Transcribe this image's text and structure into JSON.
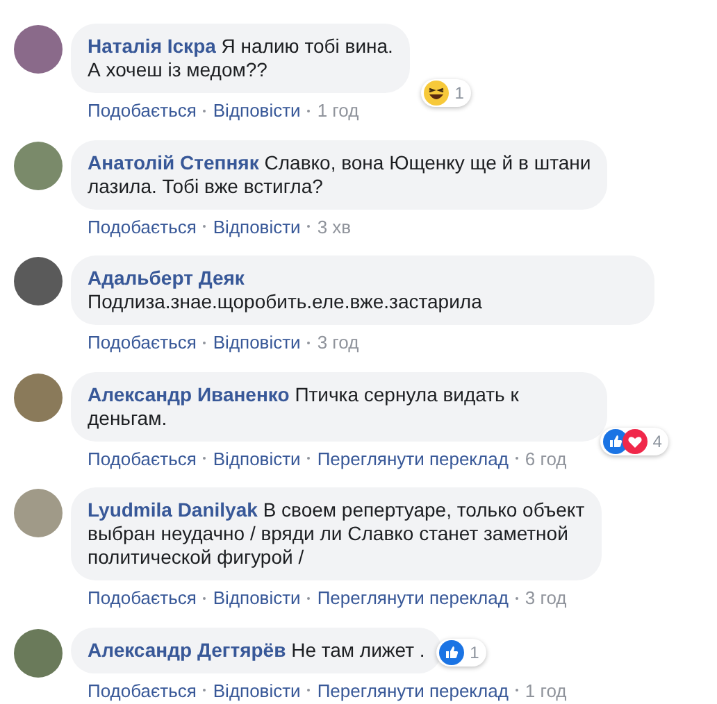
{
  "comments": [
    {
      "author": "Наталія Іскра",
      "text": "Я налию тобі вина.\nА хочеш із медом??",
      "actions": [
        "Подобається",
        "Відповісти"
      ],
      "time": "1 год",
      "reactions": {
        "icons": [
          {
            "kind": "haha"
          }
        ],
        "count": "1"
      }
    },
    {
      "author": "Анатолій Степняк",
      "text": "Славко, вона Ющенку ще й в штани\nлазила. Тобі вже встигла?",
      "actions": [
        "Подобається",
        "Відповісти"
      ],
      "time": "3 хв"
    },
    {
      "author": "Адальберт Деяк",
      "text": "Подлиза.знае.щоробить.еле.вже.застарила",
      "actions": [
        "Подобається",
        "Відповісти"
      ],
      "time": "3 год"
    },
    {
      "author": "Александр Иваненко",
      "text": "Птичка сернула видать к\nденьгам.",
      "actions": [
        "Подобається",
        "Відповісти",
        "Переглянути переклад"
      ],
      "time": "6 год",
      "reactions": {
        "icons": [
          {
            "kind": "like"
          },
          {
            "kind": "love"
          }
        ],
        "count": "4"
      }
    },
    {
      "author": "Lyudmila Danilyak",
      "text": "В своем репертуаре, только объект\nвыбран неудачно / вряди ли Славко станет заметной\nполитической фигурой /",
      "actions": [
        "Подобається",
        "Відповісти",
        "Переглянути переклад"
      ],
      "time": "3 год"
    },
    {
      "author": "Александр Дегтярёв",
      "text": "Не там лижет .",
      "actions": [
        "Подобається",
        "Відповісти",
        "Переглянути переклад"
      ],
      "time": "1 год",
      "reactions": {
        "icons": [
          {
            "kind": "like"
          }
        ],
        "count": "1"
      },
      "inline_reactions": true
    }
  ]
}
